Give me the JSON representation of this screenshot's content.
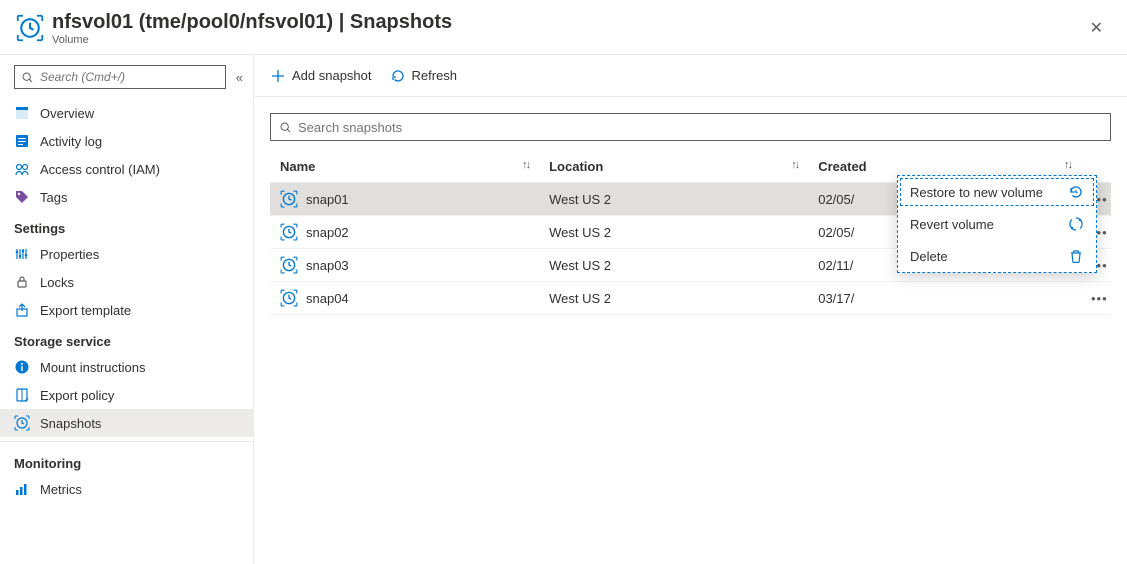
{
  "header": {
    "title": "nfsvol01 (tme/pool0/nfsvol01) | Snapshots",
    "subtitle": "Volume"
  },
  "sidebar": {
    "search_placeholder": "Search (Cmd+/)",
    "items1": [
      {
        "label": "Overview",
        "icon": "overview"
      },
      {
        "label": "Activity log",
        "icon": "activity"
      },
      {
        "label": "Access control (IAM)",
        "icon": "iam"
      },
      {
        "label": "Tags",
        "icon": "tags"
      }
    ],
    "group_settings": "Settings",
    "items2": [
      {
        "label": "Properties",
        "icon": "properties"
      },
      {
        "label": "Locks",
        "icon": "locks"
      },
      {
        "label": "Export template",
        "icon": "export"
      }
    ],
    "group_storage": "Storage service",
    "items3": [
      {
        "label": "Mount instructions",
        "icon": "info"
      },
      {
        "label": "Export policy",
        "icon": "policy"
      },
      {
        "label": "Snapshots",
        "icon": "snapshot",
        "active": true
      }
    ],
    "group_monitoring": "Monitoring",
    "items4": [
      {
        "label": "Metrics",
        "icon": "metrics"
      }
    ]
  },
  "toolbar": {
    "add": "Add snapshot",
    "refresh": "Refresh"
  },
  "table": {
    "search_placeholder": "Search snapshots",
    "cols": {
      "name": "Name",
      "location": "Location",
      "created": "Created"
    },
    "rows": [
      {
        "name": "snap01",
        "location": "West US 2",
        "created": "02/05/",
        "selected": true
      },
      {
        "name": "snap02",
        "location": "West US 2",
        "created": "02/05/"
      },
      {
        "name": "snap03",
        "location": "West US 2",
        "created": "02/11/"
      },
      {
        "name": "snap04",
        "location": "West US 2",
        "created": "03/17/"
      }
    ]
  },
  "context_menu": [
    {
      "label": "Restore to new volume",
      "icon": "restore",
      "selected": true
    },
    {
      "label": "Revert volume",
      "icon": "revert"
    },
    {
      "label": "Delete",
      "icon": "delete"
    }
  ]
}
